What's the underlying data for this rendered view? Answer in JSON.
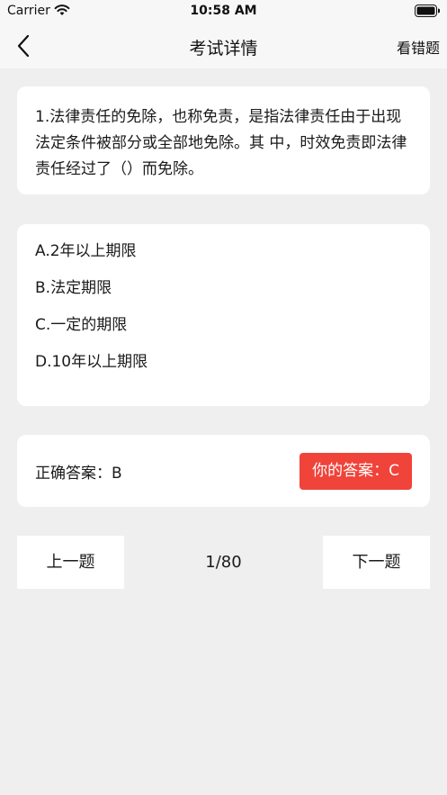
{
  "status_bar": {
    "carrier": "Carrier",
    "time": "10:58 AM",
    "icons": [
      "wifi-icon",
      "battery-icon"
    ]
  },
  "nav": {
    "back_icon": "chevron-left-icon",
    "title": "考试详情",
    "wrong_questions_label": "看错题"
  },
  "question": {
    "text": "1.法律责任的免除，也称免责，是指法律责任由于出现法定条件被部分或全部地免除。其 中，时效免责即法律责任经过了（）而免除。"
  },
  "options": [
    {
      "label": "A.2年以上期限"
    },
    {
      "label": "B.法定期限"
    },
    {
      "label": "C.一定的期限"
    },
    {
      "label": "D.10年以上期限"
    }
  ],
  "answer": {
    "correct": "正确答案：B",
    "yours": "你的答案：C",
    "yours_color": "#f0433a"
  },
  "pager": {
    "prev_label": "上一题",
    "indicator": "1/80",
    "next_label": "下一题"
  }
}
